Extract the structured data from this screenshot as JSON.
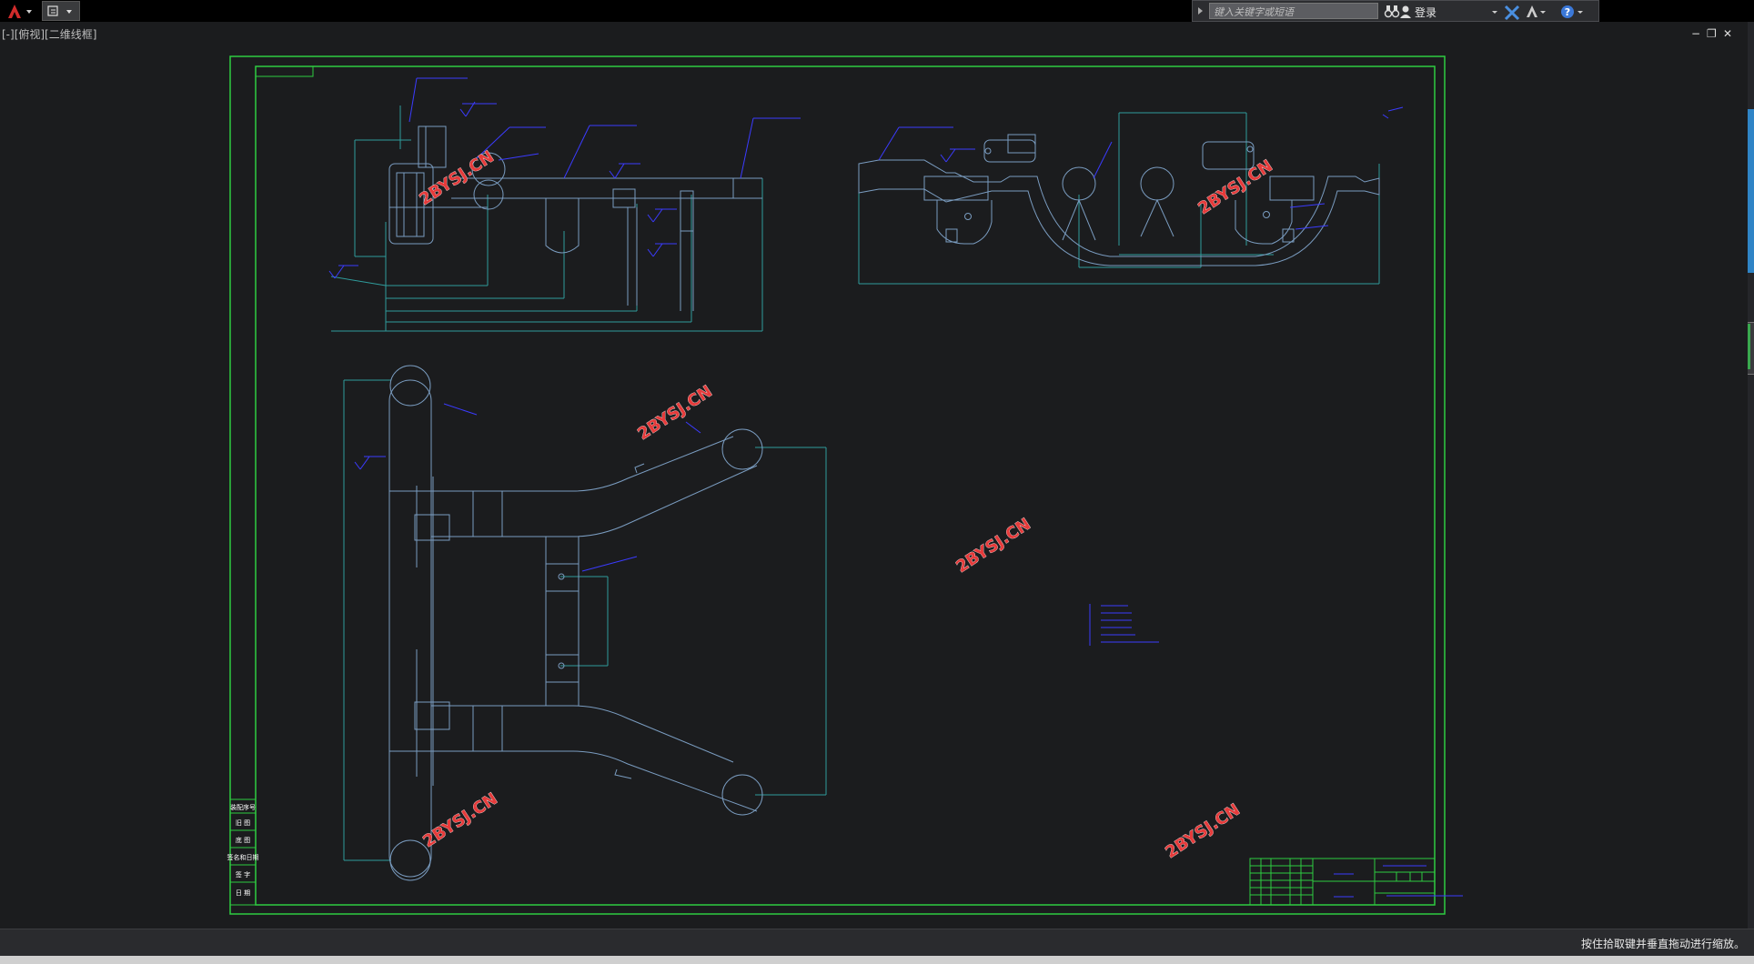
{
  "app": {
    "search_placeholder": "键入关键字或短语",
    "login_label": "登录",
    "viewport_label": "[-][俯视][二维线框]",
    "status_text": "按住拾取键并垂直拖动进行缩放。"
  },
  "drawing": {
    "watermark": "2BYSJ.CN",
    "left_column_labels": [
      "装配序号",
      "旧 图",
      "底 图",
      "签名和日期",
      "签 字",
      "日 期"
    ]
  },
  "colors": {
    "background": "#1b1c1e",
    "frame": "#2ecc40",
    "geometry": "#7a9cc0",
    "dimension": "#2f9c9c",
    "annotation": "#3b3bff",
    "watermark": "#e63b3b"
  }
}
